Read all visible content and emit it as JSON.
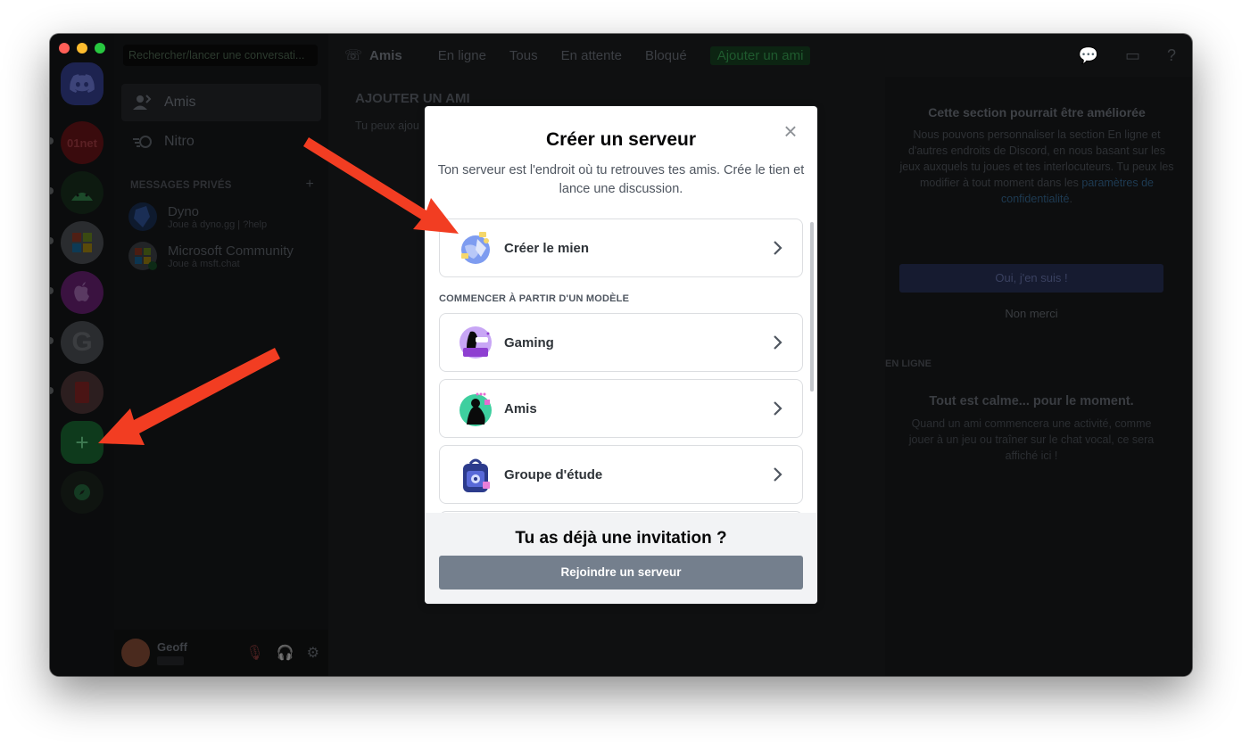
{
  "sidebar": {
    "search_placeholder": "Rechercher/lancer une conversati...",
    "nav": [
      {
        "label": "Amis",
        "icon": "friends-icon"
      },
      {
        "label": "Nitro",
        "icon": "nitro-icon"
      }
    ],
    "section_label": "MESSAGES PRIVÉS",
    "section_add": "+",
    "dms": [
      {
        "name": "Dyno",
        "status": "Joue à dyno.gg | ?help"
      },
      {
        "name": "Microsoft Community",
        "status": "Joue à msft.chat"
      }
    ]
  },
  "rail": {
    "servers": [
      "01net"
    ]
  },
  "header": {
    "title": "Amis",
    "tabs": [
      "En ligne",
      "Tous",
      "En attente",
      "Bloqué"
    ],
    "add_friend": "Ajouter un ami"
  },
  "main": {
    "title": "AJOUTER UN AMI",
    "subtitle": "Tu peux ajou"
  },
  "user": {
    "name": "Geoff"
  },
  "right": {
    "title": "Cette section pourrait être améliorée",
    "text": "Nous pouvons personnaliser la section En ligne et d'autres endroits de Discord, en nous basant sur les jeux auxquels tu joues et tes interlocuteurs. Tu peux les modifier à tout moment dans les",
    "link": "paramètres de confidentialité",
    "link_suffix": ".",
    "yes_button": "Oui, j'en suis !",
    "no_button": "Non merci",
    "online_header": "EN LIGNE",
    "calm_title": "Tout est calme... pour le moment.",
    "calm_text": "Quand un ami commencera une activité, comme jouer à un jeu ou traîner sur le chat vocal, ce sera affiché ici !"
  },
  "modal": {
    "title": "Créer un serveur",
    "subtitle": "Ton serveur est l'endroit où tu retrouves tes amis. Crée le tien et lance une discussion.",
    "create_own": "Créer le mien",
    "template_section": "COMMENCER À PARTIR D'UN MODÈLE",
    "templates": [
      "Gaming",
      "Amis",
      "Groupe d'étude"
    ],
    "footer_question": "Tu as déjà une invitation ?",
    "join_button": "Rejoindre un serveur"
  },
  "colors": {
    "modal_bg": "#ffffff",
    "join_button_bg": "#747f8d",
    "arrow": "#f23d22",
    "add_server_green": "#1e6b36"
  }
}
